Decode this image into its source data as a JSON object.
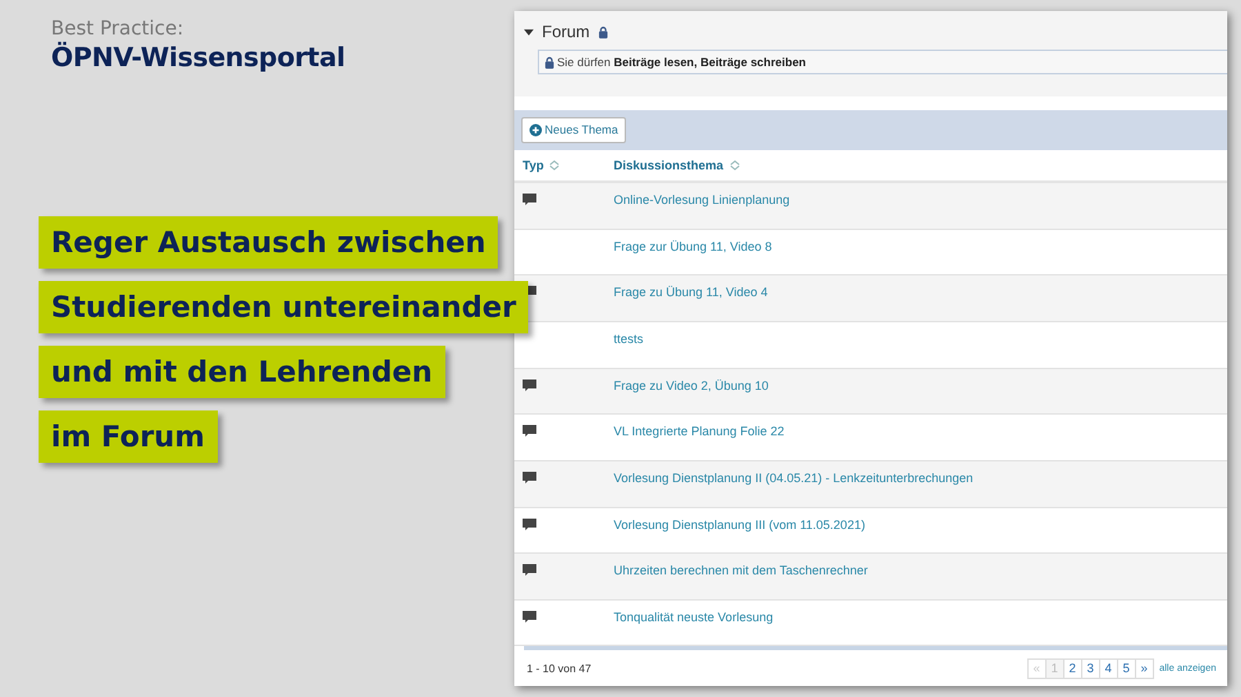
{
  "header": {
    "kicker": "Best Practice:",
    "title": "ÖPNV-Wissensportal"
  },
  "callouts": [
    "Reger Austausch zwischen",
    "Studierenden untereinander",
    "und mit den Lehrenden",
    "im Forum"
  ],
  "forum": {
    "title": "Forum",
    "expanded": true,
    "permission_prefix": "Sie dürfen ",
    "permission_rights": "Beiträge lesen, Beiträge schreiben",
    "new_button": "Neues Thema",
    "columns": [
      "Typ",
      "Diskussionsthema"
    ],
    "rows": [
      {
        "type_icon": true,
        "topic": "Online-Vorlesung Linienplanung"
      },
      {
        "type_icon": false,
        "topic": "Frage zur Übung 11, Video 8"
      },
      {
        "type_icon": true,
        "topic": "Frage zu Übung 11, Video 4"
      },
      {
        "type_icon": false,
        "topic": "ttests"
      },
      {
        "type_icon": true,
        "topic": "Frage zu Video 2, Übung 10"
      },
      {
        "type_icon": true,
        "topic": "VL Integrierte Planung Folie 22"
      },
      {
        "type_icon": true,
        "topic": "Vorlesung Dienstplanung II (04.05.21) - Lenkzeitunterbrechungen"
      },
      {
        "type_icon": true,
        "topic": "Vorlesung Dienstplanung III (vom 11.05.2021)"
      },
      {
        "type_icon": true,
        "topic": "Uhrzeiten berechnen mit dem Taschenrechner"
      },
      {
        "type_icon": true,
        "topic": "Tonqualität neuste Vorlesung"
      }
    ],
    "range": "1 - 10 von 47",
    "pages": [
      {
        "label": "«",
        "disabled": true,
        "selected": false
      },
      {
        "label": "1",
        "disabled": false,
        "selected": true
      },
      {
        "label": "2",
        "disabled": false,
        "selected": false
      },
      {
        "label": "3",
        "disabled": false,
        "selected": false
      },
      {
        "label": "4",
        "disabled": false,
        "selected": false
      },
      {
        "label": "5",
        "disabled": false,
        "selected": false
      },
      {
        "label": "»",
        "disabled": false,
        "selected": false
      }
    ],
    "show_all": "alle anzeigen"
  }
}
